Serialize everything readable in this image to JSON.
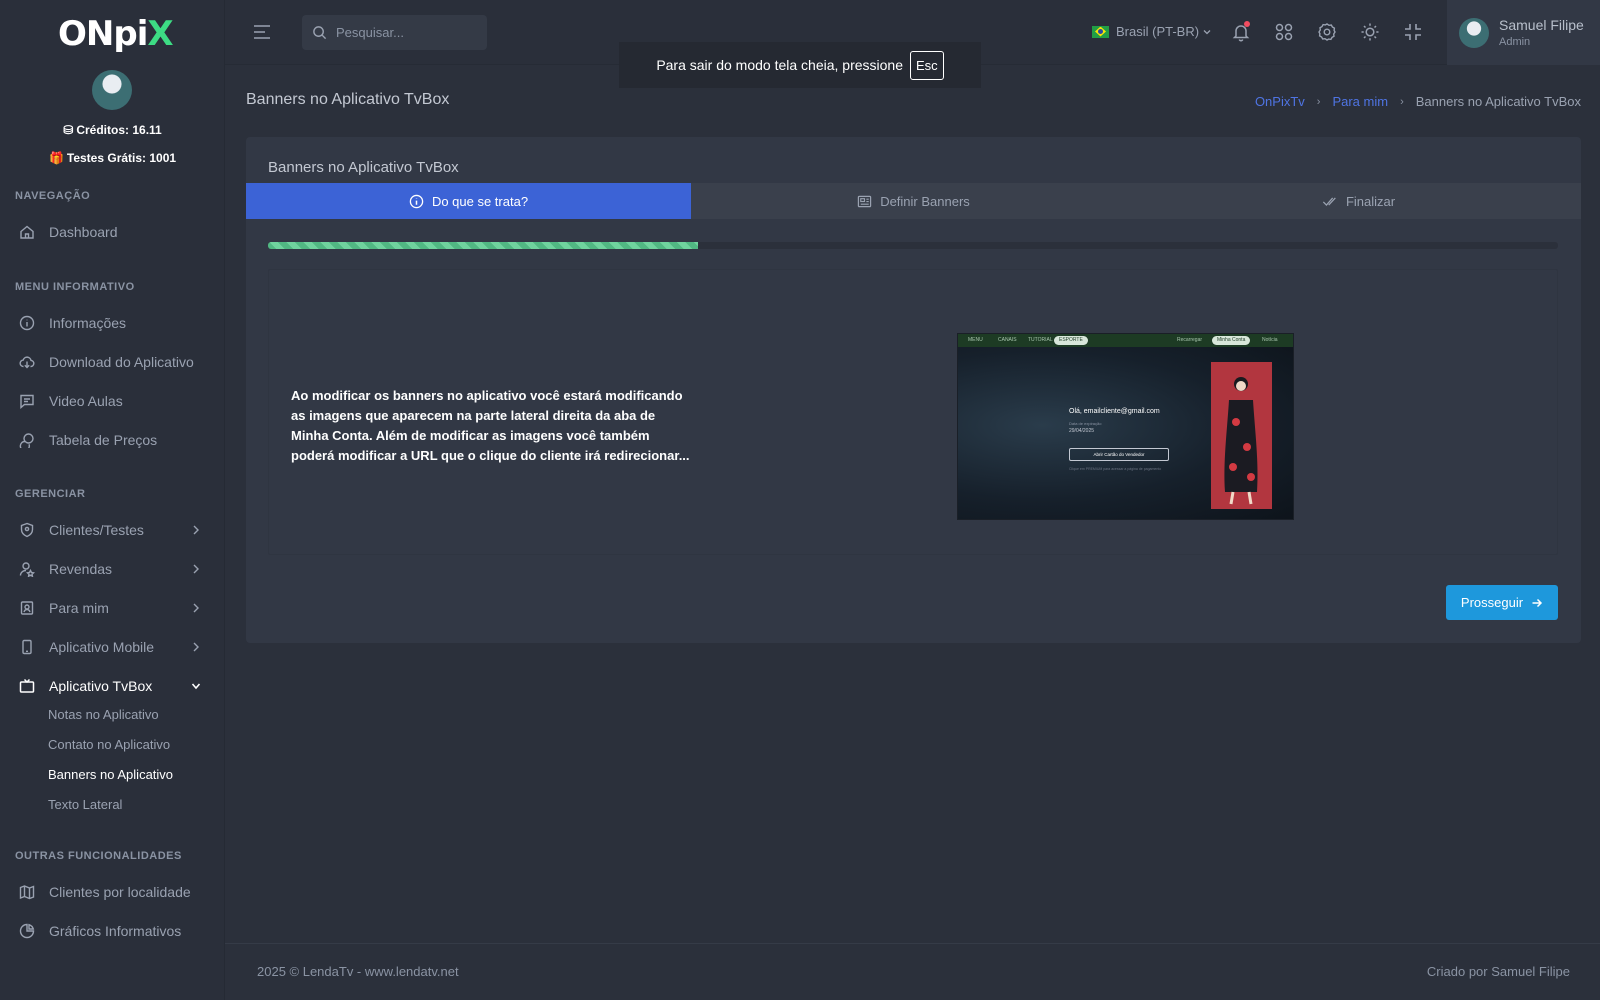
{
  "brand": {
    "logo_prefix": "ON",
    "logo_suffix": "pi",
    "logo_x": "X"
  },
  "sidebar": {
    "credits_label": "Créditos: 16.11",
    "trials_label": "Testes Grátis: 1001",
    "sections": {
      "navegacao": "NAVEGAÇÃO",
      "menu_informativo": "MENU INFORMATIVO",
      "gerenciar": "GERENCIAR",
      "outras": "OUTRAS FUNCIONALIDADES"
    },
    "items": {
      "dashboard": "Dashboard",
      "informacoes": "Informações",
      "download": "Download do Aplicativo",
      "video_aulas": "Video Aulas",
      "tabela_precos": "Tabela de Preços",
      "clientes_testes": "Clientes/Testes",
      "revendas": "Revendas",
      "para_mim": "Para mim",
      "app_mobile": "Aplicativo Mobile",
      "app_tvbox": "Aplicativo TvBox",
      "clientes_localidade": "Clientes por localidade",
      "graficos": "Gráficos Informativos"
    },
    "tvbox_sub": {
      "notas": "Notas no Aplicativo",
      "contato": "Contato no Aplicativo",
      "banners": "Banners no Aplicativo",
      "texto_lateral": "Texto Lateral"
    }
  },
  "topbar": {
    "search_placeholder": "Pesquisar...",
    "language": "Brasil (PT-BR)",
    "user_name": "Samuel Filipe",
    "user_role": "Admin"
  },
  "toast": {
    "message": "Para sair do modo tela cheia, pressione",
    "key": "Esc"
  },
  "page": {
    "title": "Banners no Aplicativo TvBox",
    "breadcrumb": [
      "OnPixTv",
      "Para mim",
      "Banners no Aplicativo TvBox"
    ]
  },
  "card": {
    "title": "Banners no Aplicativo TvBox",
    "steps": [
      "Do que se trata?",
      "Definir Banners",
      "Finalizar"
    ],
    "progress_percent": 33.3,
    "description": "Ao modificar os banners no aplicativo você estará modificando as imagens que aparecem na parte lateral direita da aba de Minha Conta. Além de modificar as imagens você também poderá modificar a URL que o clique do cliente irá redirecionar...",
    "proceed_label": "Prosseguir"
  },
  "preview": {
    "tabs": [
      "MENU",
      "CANAIS",
      "TUTORIAL",
      "ESPORTE"
    ],
    "right_tabs": [
      "Recarregar",
      "Minha Conta",
      "Notícia"
    ],
    "hello": "Olá, emailcliente@gmail.com",
    "expiry_label": "Data de expiração",
    "expiry_date": "29/04/2025",
    "button": "Abrir Cartão do Vendedor",
    "footer_note": "Clique em PREMIUM para acessar a página de pagamento"
  },
  "footer": {
    "left": "2025 © LendaTv - www.lendatv.net",
    "right": "Criado por Samuel Filipe"
  },
  "colors": {
    "accent": "#3c63d6",
    "button": "#1e98dc",
    "progress": "#51b883",
    "link": "#4f74e3"
  }
}
